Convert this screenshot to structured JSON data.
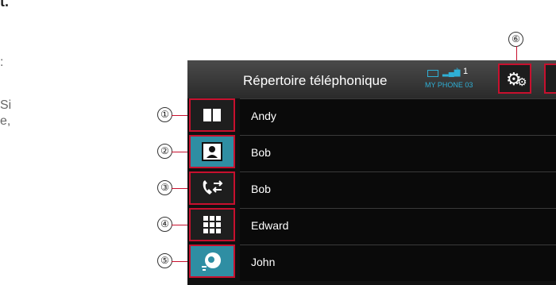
{
  "page_text": [
    {
      "id": "frag-0",
      "text": "t."
    },
    {
      "id": "frag-1",
      "text": ":"
    },
    {
      "id": "frag-2",
      "text": "Si"
    },
    {
      "id": "frag-3",
      "text": "e,"
    }
  ],
  "callouts": {
    "c1": "①",
    "c2": "②",
    "c3": "③",
    "c4": "④",
    "c5": "⑤",
    "c6": "⑥"
  },
  "header": {
    "title": "Répertoire téléphonique",
    "phone_number": "1",
    "device_name": "MY PHONE 03",
    "settings_icon": "gear-icon"
  },
  "side_buttons": [
    {
      "name": "phonebook-button",
      "icon": "book-icon",
      "glyph": "📖"
    },
    {
      "name": "contact-button",
      "icon": "contact-card-icon",
      "glyph": ""
    },
    {
      "name": "call-history-button",
      "icon": "call-transfer-icon",
      "glyph": "✆⇄"
    },
    {
      "name": "keypad-button",
      "icon": "keypad-icon",
      "glyph": "▦"
    },
    {
      "name": "voice-button",
      "icon": "voice-icon",
      "glyph": "●"
    }
  ],
  "contacts": [
    {
      "name": "Andy"
    },
    {
      "name": "Bob"
    },
    {
      "name": "Bob"
    },
    {
      "name": "Edward"
    },
    {
      "name": "John"
    }
  ],
  "colors": {
    "accent": "#2f8ea3",
    "highlight": "#c8102e",
    "status": "#2fb0d6"
  }
}
